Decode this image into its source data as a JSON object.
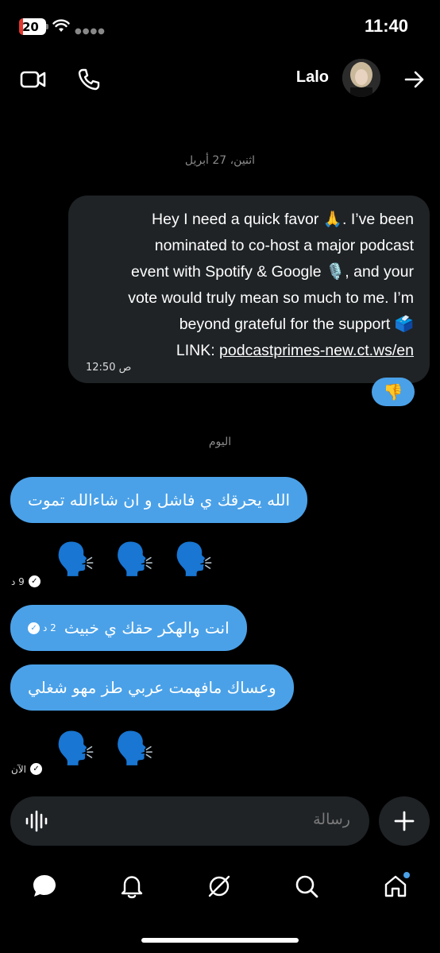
{
  "status_bar": {
    "battery": "20",
    "time": "11:40",
    "icons": [
      "battery-icon",
      "wifi-icon",
      "signal-icon"
    ]
  },
  "header": {
    "contact_name": "Lalo",
    "icons": [
      "video-call-icon",
      "phone-call-icon",
      "avatar",
      "forward-arrow-icon"
    ]
  },
  "conversation": {
    "date_1": "اثنين، 27 أبريل",
    "outgoing": {
      "lines": [
        "Hey I need a quick favor 🙏. I’ve been",
        "nominated to co-host a major podcast",
        "event with Spotify & Google 🎙️, and your",
        "vote would truly mean so much to me. I’m",
        "beyond grateful for the support 🗳️"
      ],
      "link_prefix": "LINK: ",
      "link": "podcastprimes-new.ct.ws/en",
      "time": "12:50 ص",
      "reaction": "👎"
    },
    "date_2": "اليوم",
    "incoming": [
      {
        "type": "text",
        "text": "الله يحرقك ي فاشل و ان شاءالله تموت"
      },
      {
        "type": "emoji",
        "text": "🗣️ 🗣️ 🗣️",
        "meta": "9 د"
      },
      {
        "type": "text",
        "text": "انت والهكر حقك ي خبيث",
        "meta": "2 د"
      },
      {
        "type": "text",
        "text": "وعساك مافهمت عربي طز مهو شغلي"
      },
      {
        "type": "emoji",
        "text": "🗣️ 🗣️",
        "meta": "الآن"
      }
    ]
  },
  "composer": {
    "placeholder": "رسالة",
    "icons": [
      "voice-wave-icon",
      "plus-icon"
    ]
  },
  "nav": {
    "items": [
      "chat-bubble-icon",
      "bell-icon",
      "grok-icon",
      "search-icon",
      "home-icon"
    ]
  },
  "colors": {
    "background": "#000000",
    "incoming_bubble": "#4aa1e8",
    "outgoing_bubble": "#1f2326",
    "accent": "#4aa1e8"
  }
}
